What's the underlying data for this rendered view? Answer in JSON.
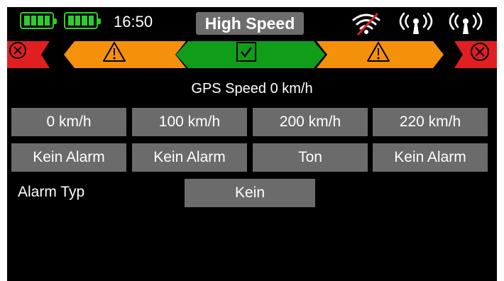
{
  "status_bar": {
    "time": "16:50",
    "mode_label": "High Speed",
    "battery_color": "#2ecc2e",
    "icons": [
      "battery-icon",
      "battery-icon",
      "wifi-disabled-icon",
      "antenna-signal-icon",
      "antenna-signal-icon"
    ]
  },
  "indicator_strip": {
    "segments": [
      {
        "icon": "error-circle-x-icon",
        "color": "#e02020"
      },
      {
        "icon": "warning-triangle-icon",
        "color": "#f5900b"
      },
      {
        "icon": "checkbox-check-icon",
        "color": "#0f9d1a"
      },
      {
        "icon": "warning-triangle-icon",
        "color": "#f5900b"
      },
      {
        "icon": "error-circle-x-icon",
        "color": "#e02020"
      }
    ]
  },
  "speed": {
    "label": "GPS  Speed 0 km/h"
  },
  "thresholds": [
    "0 km/h",
    "100 km/h",
    "200 km/h",
    "220 km/h"
  ],
  "alarms": [
    "Kein Alarm",
    "Kein Alarm",
    "Ton",
    "Kein Alarm"
  ],
  "alarm_type": {
    "label": "Alarm Typ",
    "value": "Kein"
  },
  "colors": {
    "background": "#000000",
    "button": "#6b6b6b",
    "mode_badge": "#6d6d6d"
  }
}
